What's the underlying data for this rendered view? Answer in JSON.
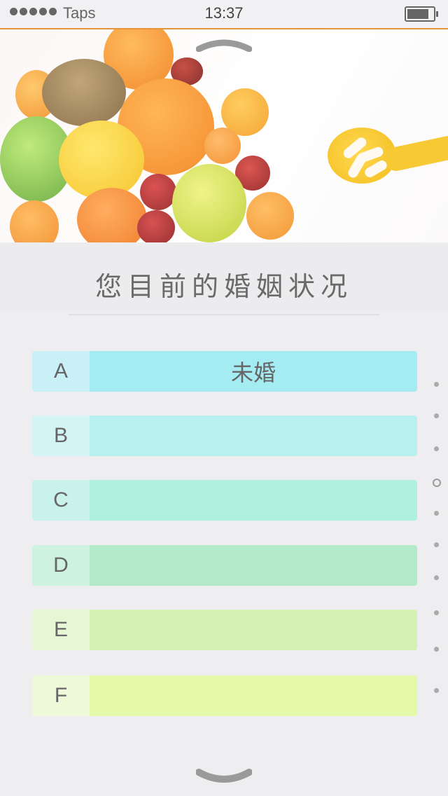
{
  "status": {
    "carrier": "Taps",
    "time": "13:37"
  },
  "question": "您目前的婚姻状况",
  "options": [
    {
      "letter": "A",
      "text": "未婚",
      "letter_bg": "#c8f0f6",
      "bar_bg": "#a4ecf2"
    },
    {
      "letter": "B",
      "text": "",
      "letter_bg": "#d3f3f5",
      "bar_bg": "#b9f0f0"
    },
    {
      "letter": "C",
      "text": "",
      "letter_bg": "#c8f2ea",
      "bar_bg": "#aff0de"
    },
    {
      "letter": "D",
      "text": "",
      "letter_bg": "#cdf2df",
      "bar_bg": "#b3ebca"
    },
    {
      "letter": "E",
      "text": "",
      "letter_bg": "#e6f7d6",
      "bar_bg": "#d5f1b3"
    },
    {
      "letter": "F",
      "text": "",
      "letter_bg": "#eef9da",
      "bar_bg": "#e4f9a9"
    }
  ],
  "pager": {
    "current_index": 3,
    "count": 10
  },
  "icons": {
    "collapse": "chevron-up-icon",
    "expand": "chevron-down-icon",
    "battery": "battery-icon",
    "signal": "signal-icon"
  }
}
